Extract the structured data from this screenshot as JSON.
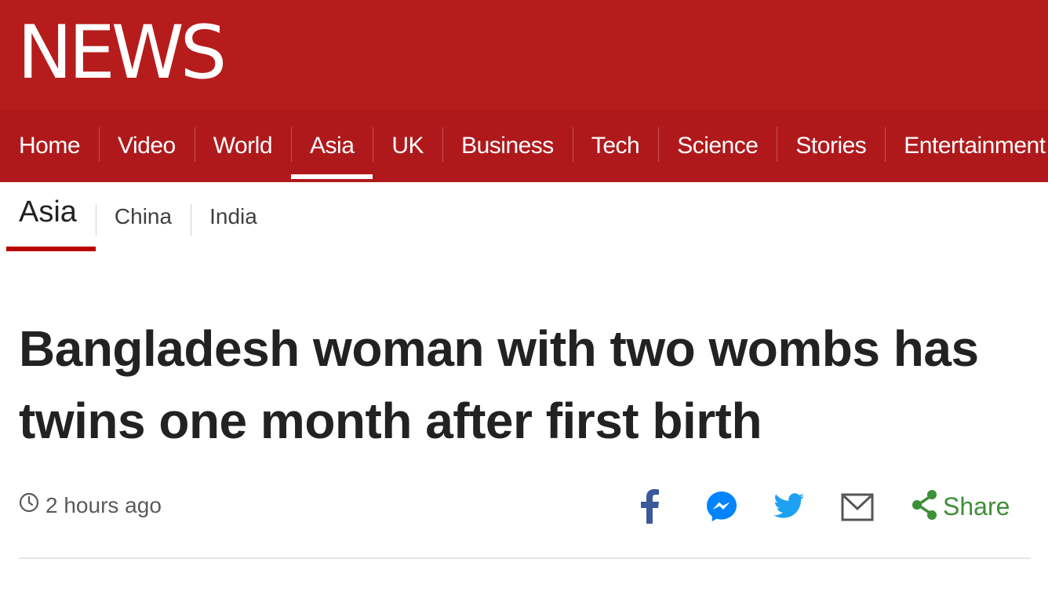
{
  "masthead": {
    "logo_text": "NEWS",
    "color": "#b71c1c"
  },
  "nav": {
    "items": [
      {
        "label": "Home"
      },
      {
        "label": "Video"
      },
      {
        "label": "World"
      },
      {
        "label": "Asia",
        "active": true
      },
      {
        "label": "UK"
      },
      {
        "label": "Business"
      },
      {
        "label": "Tech"
      },
      {
        "label": "Science"
      },
      {
        "label": "Stories"
      },
      {
        "label": "Entertainment &"
      }
    ]
  },
  "subnav": {
    "items": [
      {
        "label": "Asia",
        "active": true
      },
      {
        "label": "China"
      },
      {
        "label": "India"
      }
    ]
  },
  "article": {
    "headline": "Bangladesh woman with two wombs has twins one month after first birth",
    "timestamp": "2 hours ago"
  },
  "share": {
    "icons": [
      "facebook-icon",
      "messenger-icon",
      "twitter-icon",
      "email-icon",
      "share-icon"
    ],
    "label": "Share",
    "colors": {
      "facebook": "#3b5998",
      "messenger": "#0084ff",
      "twitter": "#1da1f2",
      "email": "#555555",
      "share": "#3d8f38"
    }
  }
}
